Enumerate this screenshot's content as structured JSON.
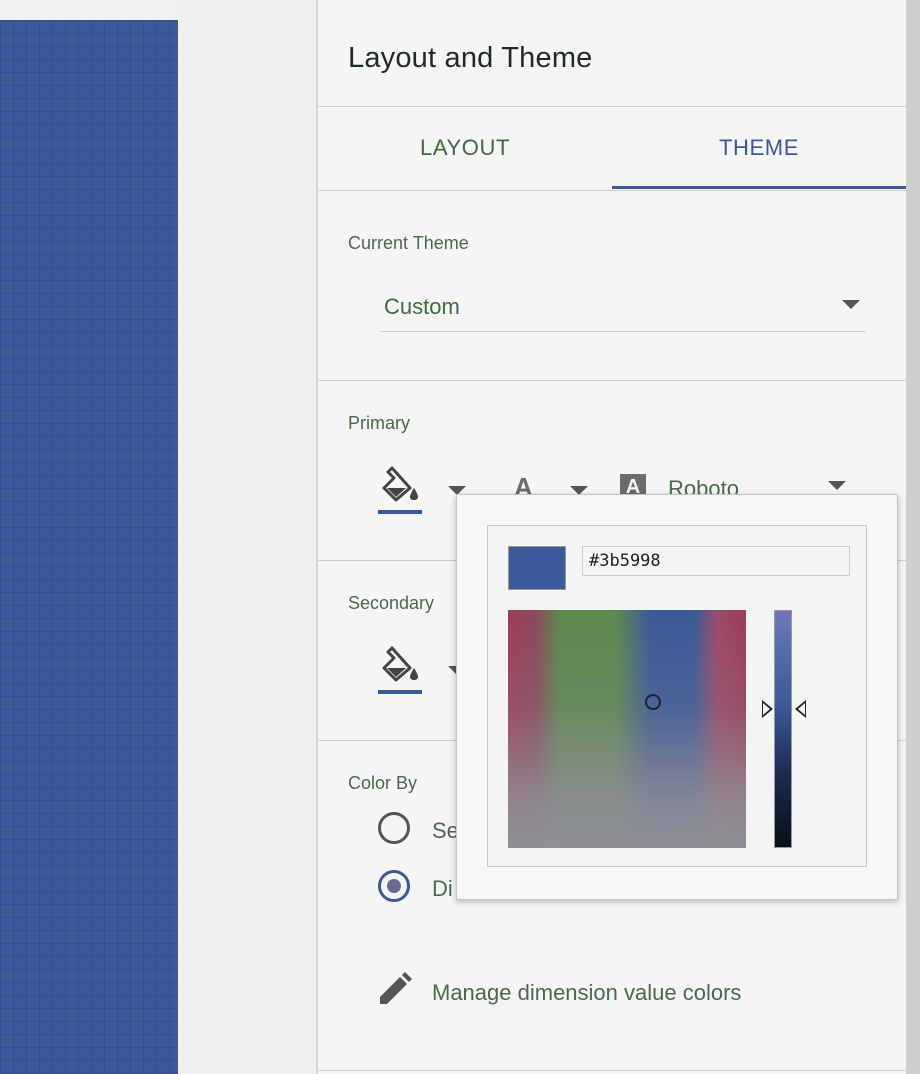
{
  "panel": {
    "title": "Layout and Theme",
    "tabs": [
      {
        "label": "LAYOUT",
        "active": false
      },
      {
        "label": "THEME",
        "active": true
      }
    ]
  },
  "theme": {
    "current_theme_label": "Current Theme",
    "current_theme_value": "Custom",
    "primary_label": "Primary",
    "primary_font": "Roboto",
    "secondary_label": "Secondary",
    "color_by_label": "Color By",
    "color_by_options": [
      {
        "label": "Se",
        "checked": false
      },
      {
        "label": "Di",
        "checked": true
      }
    ],
    "manage_colors_label": "Manage dimension value colors"
  },
  "color_picker": {
    "hex_value": "#3b5998"
  },
  "colors": {
    "accent": "#3b5998",
    "canvas": "#3b5998"
  },
  "icons": [
    "paint-bucket-icon",
    "chevron-down-icon",
    "text-color-icon",
    "font-family-icon",
    "pencil-icon"
  ]
}
